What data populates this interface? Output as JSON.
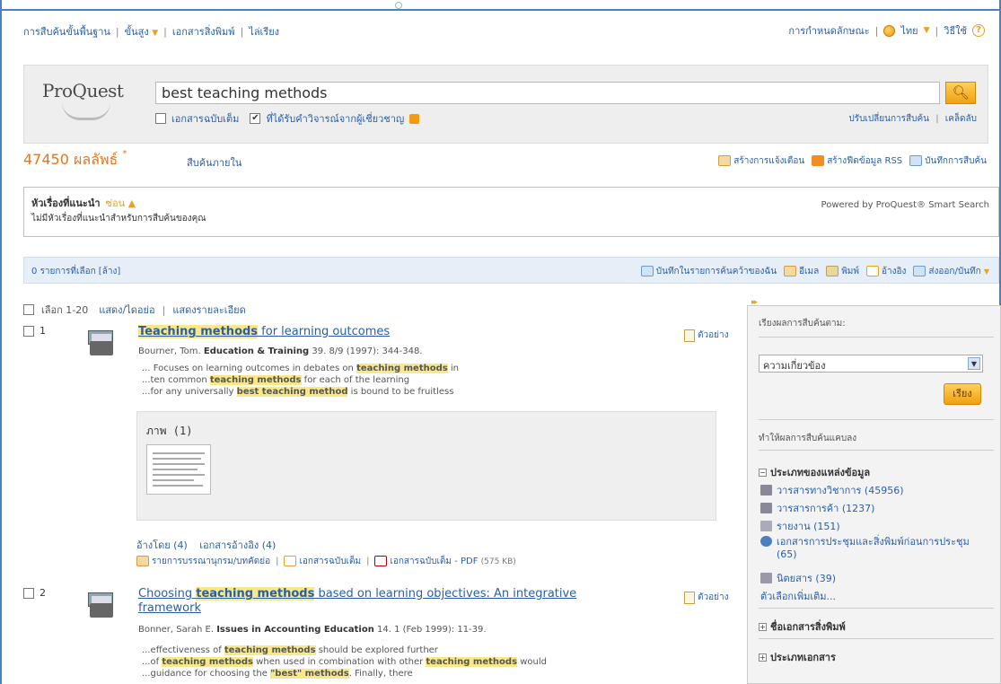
{
  "top_nav": {
    "basic_search": "การสืบค้นขั้นพื้นฐาน",
    "advanced": "ขั้นสูง",
    "publications": "เอกสารสิ่งพิมพ์",
    "browse": "ไล่เรียง"
  },
  "top_right": {
    "preferences": "การกำหนดลักษณะ",
    "language": "ไทย",
    "help": "วิธีใช้"
  },
  "search": {
    "logo": "ProQuest",
    "query": "best teaching methods",
    "fulltext_label": "เอกสารฉบับเต็ม",
    "peer_reviewed_label": "ที่ได้รับคำวิจารณ์จากผู้เชี่ยวชาญ",
    "peer_reviewed_checked": "✔",
    "modify_search": "ปรับเปลี่ยนการสืบค้น",
    "tips": "เคล็ดลับ"
  },
  "results": {
    "count": "47450 ผลลัพธ์",
    "star": "*",
    "search_within": "สืบค้นภายใน",
    "create_alert": "สร้างการแจ้งเตือน",
    "create_rss": "สร้างฟีดข้อมูล RSS",
    "save_search": "บันทึกการสืบค้น"
  },
  "topics": {
    "heading": "หัวเรื่องที่แนะนำ",
    "hide": "ซ่อน",
    "empty_text": "ไม่มีหัวเรื่องที่แนะนำสำหรับการสืบค้นของคุณ",
    "powered_by": "Powered by ProQuest® Smart Search"
  },
  "selection_bar": {
    "selected": "0 รายการที่เลือก [ล้าง]",
    "save_to_research": "บันทึกในรายการค้นคว้าของฉัน",
    "email": "อีเมล",
    "print": "พิมพ์",
    "cite": "อ้างอิง",
    "export": "ส่งออก/บันทึก"
  },
  "list_header": {
    "select_range": "เลือก 1-20",
    "brief_view": "แสดง/ไดอย่อ",
    "detailed_view": "แสดงรายละเอียด"
  },
  "records": [
    {
      "number": "1",
      "title_hl": "Teaching methods",
      "title_rest": " for learning outcomes",
      "preview": "ตัวอย่าง",
      "author": "Bourner, Tom.",
      "journal": "Education & Training",
      "citation": " 39. 8/9 (1997): 344-348.",
      "s1a": "... Focuses on learning outcomes in debates on ",
      "s1h": "teaching methods",
      "s1b": " in",
      "s2a": "...ten common ",
      "s2h": "teaching methods",
      "s2b": " for each of the learning",
      "s3a": "...for any universally ",
      "s3h": "best teaching method",
      "s3b": " is bound to be fruitless",
      "figures_label": "ภาพ (1)",
      "cited_by": "อ้างโดย (4)",
      "references": "เอกสารอ้างอิง (4)",
      "abstract": "รายการบรรณานุกรม/บทคัดย่อ",
      "full_text": "เอกสารฉบับเต็ม",
      "full_text_pdf": "เอกสารฉบับเต็ม - PDF",
      "pdf_size": "(575 KB)"
    },
    {
      "number": "2",
      "title_a": "Choosing ",
      "title_hl": "teaching methods",
      "title_b": " based on learning objectives: An integrative framework",
      "preview": "ตัวอย่าง",
      "author": "Bonner, Sarah E.",
      "journal": "Issues in Accounting Education",
      "citation": " 14. 1 (Feb 1999): 11-39.",
      "s1a": "...effectiveness of ",
      "s1h": "teaching methods",
      "s1b": " should be explored further",
      "s2a": "...of ",
      "s2h": "teaching methods",
      "s2b": " when used in combination with other ",
      "s2h2": "teaching methods",
      "s2c": " would",
      "s3a": "...guidance for choosing the ",
      "s3h": "\"best\" methods",
      "s3b": ". Finally, there"
    }
  ],
  "sidebar": {
    "sort_label": "เรียงผลการสืบค้นตาม:",
    "sort_value": "ความเกี่ยวข้อง",
    "sort_button": "เรียง",
    "narrow_label": "ทำให้ผลการสืบค้นแคบลง",
    "source_type": "ประเภทของแหล่งข้อมูล",
    "sources": [
      {
        "label": "วารสารทางวิชาการ (45956)"
      },
      {
        "label": "วารสารการค้า (1237)"
      },
      {
        "label": "รายงาน (151)"
      },
      {
        "label": "เอกสารการประชุมและสิ่งพิมพ์ก่อนการประชุม (65)"
      },
      {
        "label": "นิตยสาร (39)"
      }
    ],
    "more_options": "ตัวเลือกเพิ่มเติม...",
    "publication_title": "ชื่อเอกสารสิ่งพิมพ์",
    "doc_type": "ประเภทเอกสาร"
  },
  "colors": {
    "accent": "#e07820",
    "link": "#2a5ea8",
    "highlight": "#f8e888"
  }
}
